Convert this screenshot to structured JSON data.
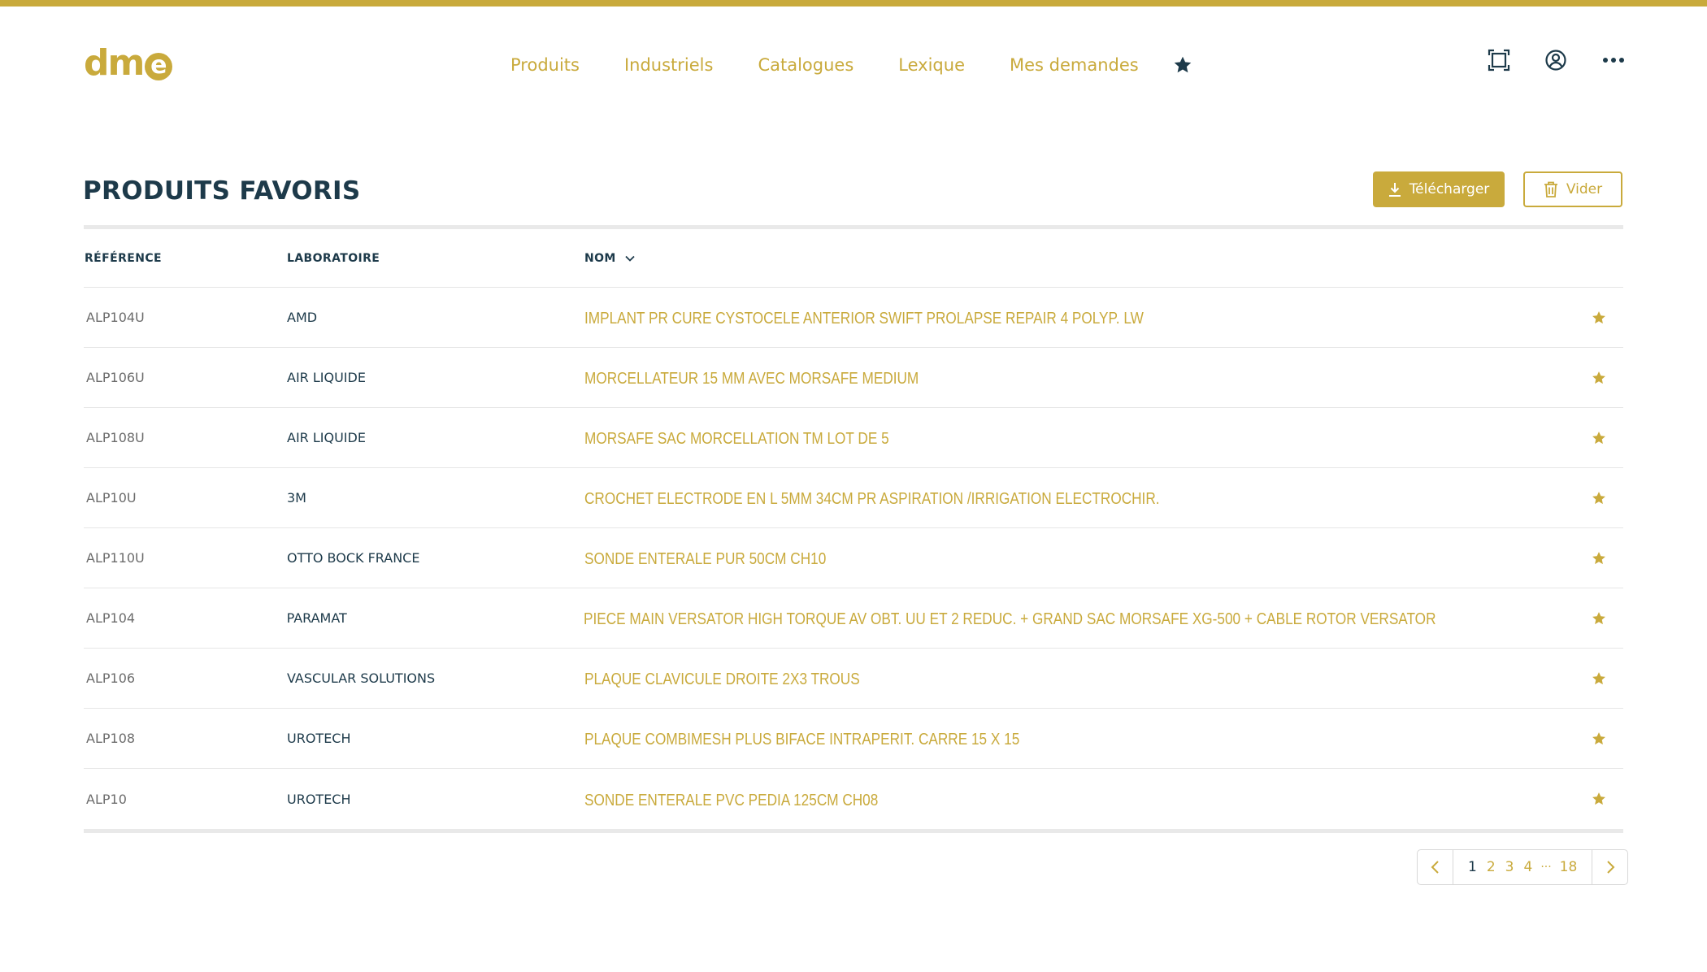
{
  "brand": {
    "logo_text": "dm",
    "logo_mark": "e",
    "accent_color": "#c9aa3c",
    "primary_color": "#1d3a4a"
  },
  "nav": {
    "items": [
      {
        "label": "Produits"
      },
      {
        "label": "Industriels"
      },
      {
        "label": "Catalogues"
      },
      {
        "label": "Lexique"
      },
      {
        "label": "Mes demandes"
      }
    ],
    "favorites_icon": "star-icon"
  },
  "header_icons": [
    "fullscreen-icon",
    "user-account-icon",
    "more-options-icon"
  ],
  "page": {
    "title": "PRODUITS FAVORIS",
    "download_label": "Télécharger",
    "clear_label": "Vider"
  },
  "table": {
    "columns": [
      "RÉFÉRENCE",
      "LABORATOIRE",
      "NOM"
    ],
    "sort_column": "NOM",
    "rows": [
      {
        "ref": "ALP104U",
        "lab": "AMD",
        "nom": "IMPLANT PR CURE CYSTOCELE ANTERIOR SWIFT PROLAPSE REPAIR 4 POLYP. LW"
      },
      {
        "ref": "ALP106U",
        "lab": "AIR LIQUIDE",
        "nom": "MORCELLATEUR 15 MM AVEC MORSAFE MEDIUM"
      },
      {
        "ref": "ALP108U",
        "lab": "AIR LIQUIDE",
        "nom": "MORSAFE SAC MORCELLATION TM LOT DE 5"
      },
      {
        "ref": "ALP10U",
        "lab": "3M",
        "nom": "CROCHET ELECTRODE EN L 5MM 34CM PR ASPIRATION /IRRIGATION ELECTROCHIR."
      },
      {
        "ref": "ALP110U",
        "lab": "OTTO BOCK FRANCE",
        "nom": "SONDE ENTERALE PUR 50CM CH10"
      },
      {
        "ref": "ALP104",
        "lab": "PARAMAT",
        "nom": "PIECE MAIN VERSATOR HIGH TORQUE AV OBT. UU ET 2 REDUC. + GRAND SAC MORSAFE XG-500 + CABLE ROTOR VERSATOR"
      },
      {
        "ref": "ALP106",
        "lab": "VASCULAR SOLUTIONS",
        "nom": "PLAQUE CLAVICULE DROITE 2X3 TROUS"
      },
      {
        "ref": "ALP108",
        "lab": "UROTECH",
        "nom": "PLAQUE COMBIMESH PLUS BIFACE INTRAPERIT. CARRE 15 X 15"
      },
      {
        "ref": "ALP10",
        "lab": "UROTECH",
        "nom": "SONDE ENTERALE PVC PEDIA 125CM CH08"
      }
    ]
  },
  "pagination": {
    "pages": [
      "1",
      "2",
      "3",
      "4"
    ],
    "ellipsis": "···",
    "last_page": "18",
    "current": "1"
  }
}
